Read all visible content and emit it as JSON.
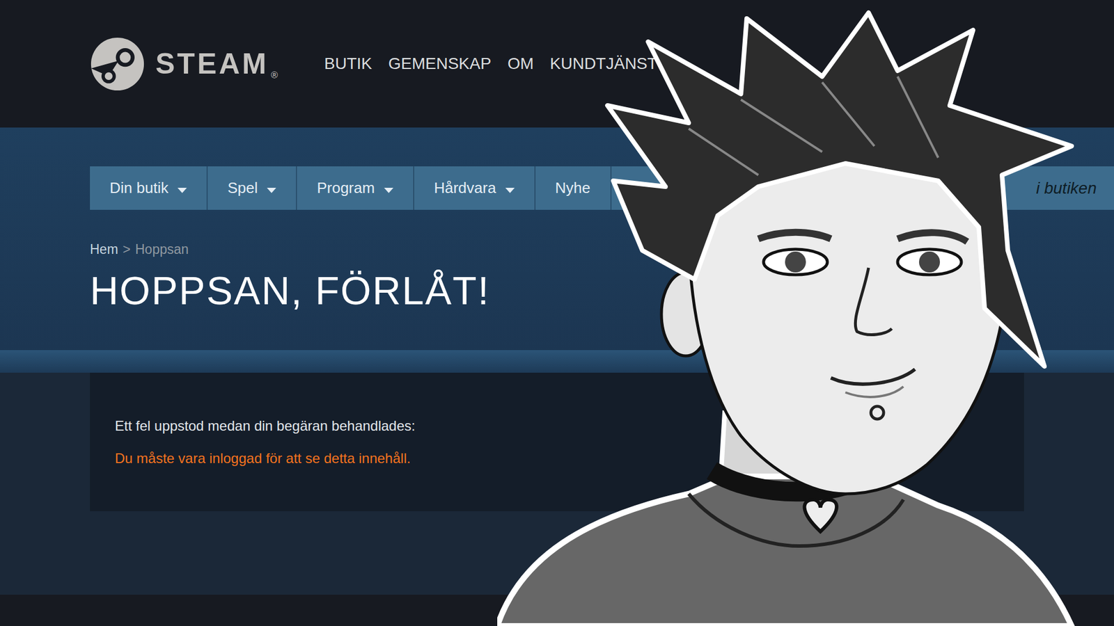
{
  "header": {
    "logo_text": "STEAM",
    "logo_mark": "®",
    "nav": [
      "BUTIK",
      "GEMENSKAP",
      "OM",
      "KUNDTJÄNST"
    ]
  },
  "store_tabs": [
    {
      "label": "Din butik",
      "dropdown": true
    },
    {
      "label": "Spel",
      "dropdown": true
    },
    {
      "label": "Program",
      "dropdown": true
    },
    {
      "label": "Hårdvara",
      "dropdown": true
    },
    {
      "label": "Nyhe",
      "dropdown": false
    }
  ],
  "search": {
    "placeholder": "i butiken"
  },
  "breadcrumb": {
    "separator": ">",
    "items": [
      {
        "label": "Hem",
        "current": false
      },
      {
        "label": "Hoppsan",
        "current": true
      }
    ]
  },
  "page": {
    "title": "HOPPSAN, FÖRLÅT!"
  },
  "error": {
    "intro": "Ett fel uppstod medan din begäran behandlades:",
    "message": "Du måste vara inloggad för att se detta innehåll."
  }
}
